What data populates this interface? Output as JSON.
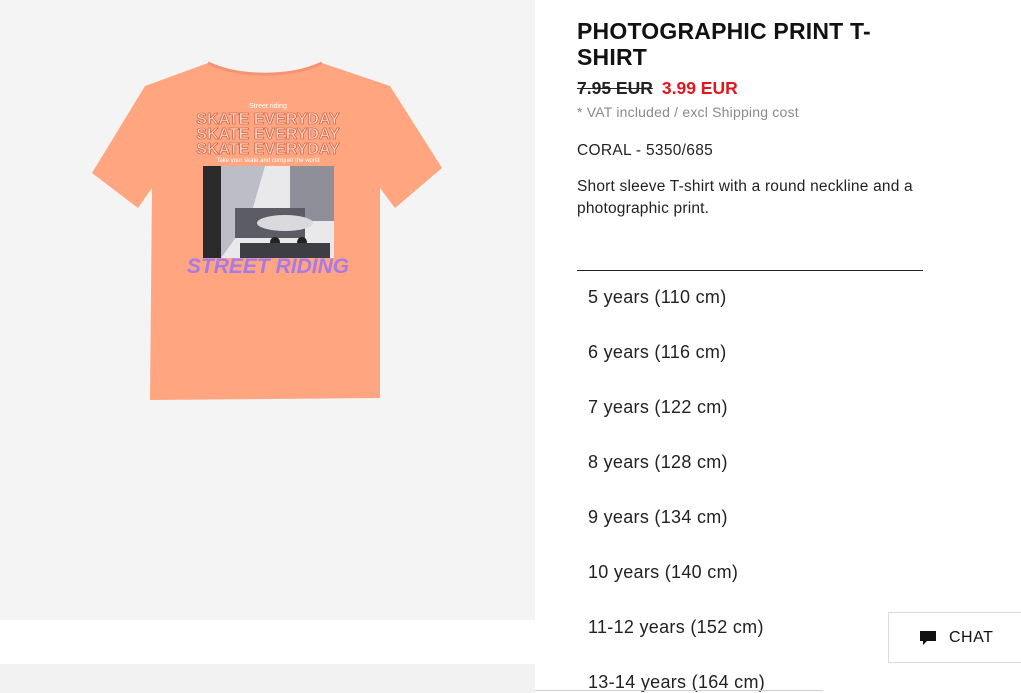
{
  "product": {
    "title": "PHOTOGRAPHIC PRINT T-SHIRT",
    "old_price": "7.95 EUR",
    "new_price": "3.99 EUR",
    "vat_note": "* VAT included / excl Shipping cost",
    "color_ref": "CORAL - 5350/685",
    "description": "Short sleeve T-shirt with a round neckline and a photographic print."
  },
  "print": {
    "small_top": "Street riding",
    "headline": "SKATE EVERYDAY",
    "tagline": "Take your skate and conquer the world",
    "footer": "STREET RIDING"
  },
  "sizes": [
    "5 years (110 cm)",
    "6 years (116 cm)",
    "7 years (122 cm)",
    "8 years (128 cm)",
    "9 years (134 cm)",
    "10 years (140 cm)",
    "11-12 years (152 cm)",
    "13-14 years (164 cm)"
  ],
  "chat": {
    "label": "CHAT",
    "icon": "chat-bubble-icon"
  },
  "colors": {
    "sale_red": "#e3151e",
    "shirt_coral": "#ffa57f",
    "print_purple": "#a77ae8"
  }
}
